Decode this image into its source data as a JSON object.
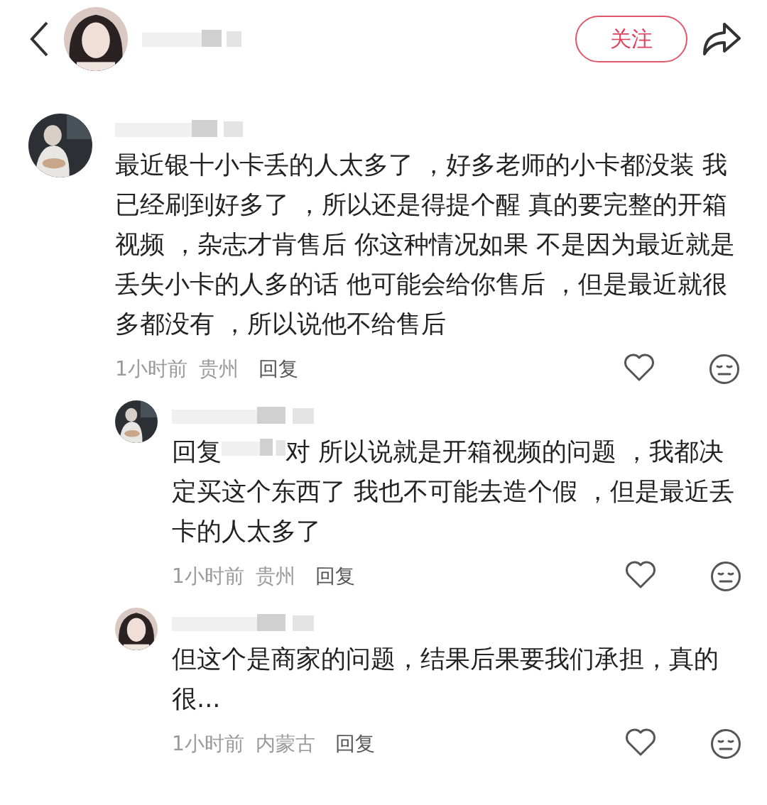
{
  "header": {
    "follow_button": "关注"
  },
  "comments": [
    {
      "kind": "comment",
      "text": "最近银十小卡丢的人太多了 ，好多老师的小卡都没装 我已经刷到好多了 ，所以还是得提个醒 真的要完整的开箱视频 ，杂志才肯售后 你这种情况如果 不是因为最近就是丢失小卡的人多的话 他可能会给你售后 ，但是最近就很多都没有 ，所以说他不给售后",
      "time": "1小时前",
      "location": "贵州",
      "reply": "回复"
    },
    {
      "kind": "reply",
      "prefix": "回复",
      "text": "对 所以说就是开箱视频的问题 ，我都决定买这个东西了 我也不可能去造个假 ，但是最近丢卡的人太多了",
      "time": "1小时前",
      "location": "贵州",
      "reply": "回复"
    },
    {
      "kind": "reply",
      "text": "但这个是商家的问题，结果后果要我们承担，真的很...",
      "time": "1小时前",
      "location": "内蒙古",
      "reply": "回复"
    }
  ]
}
